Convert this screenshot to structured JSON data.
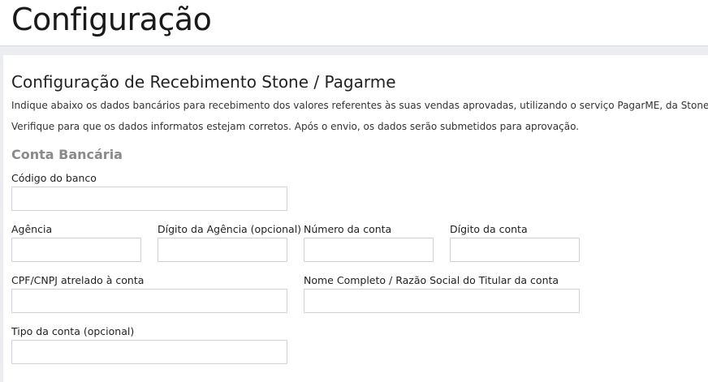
{
  "header": {
    "title": "Configuração"
  },
  "section": {
    "title": "Configuração de Recebimento Stone / Pagarme",
    "description_1": "Indique abaixo os dados bancários para recebimento dos valores referentes às suas vendas aprovadas, utilizando o serviço PagarME, da Stone.",
    "description_2": "Verifique para que os dados informatos estejam corretos. Após o envio, os dados serão submetidos para aprovação."
  },
  "bank_account": {
    "title": "Conta Bancária",
    "fields": {
      "bank_code": {
        "label": "Código do banco",
        "value": ""
      },
      "agency": {
        "label": "Agência",
        "value": ""
      },
      "agency_digit": {
        "label": "Dígito da Agência (opcional)",
        "value": ""
      },
      "account_number": {
        "label": "Número da conta",
        "value": ""
      },
      "account_digit": {
        "label": "Dígito da conta",
        "value": ""
      },
      "document": {
        "label": "CPF/CNPJ atrelado à conta",
        "value": ""
      },
      "holder_name": {
        "label": "Nome Completo / Razão Social do Titular da conta",
        "value": ""
      },
      "account_type": {
        "label": "Tipo da conta (opcional)",
        "value": ""
      }
    }
  }
}
